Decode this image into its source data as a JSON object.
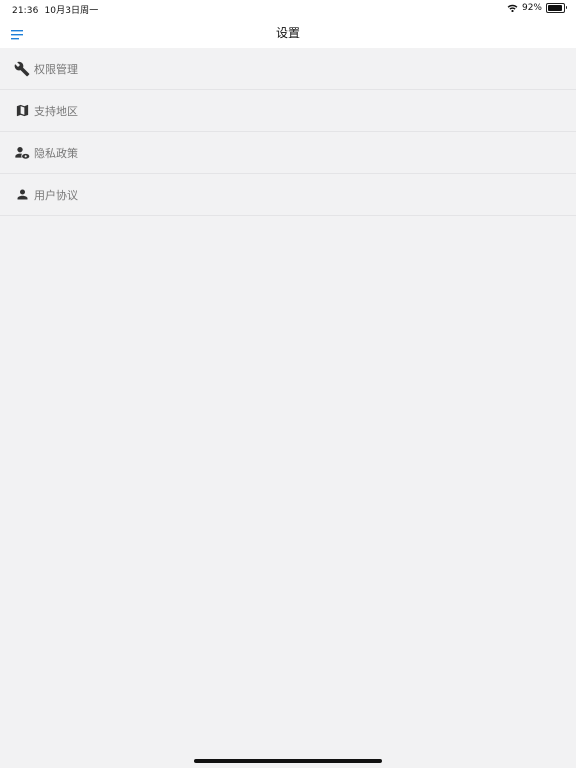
{
  "status_bar": {
    "time": "21:36",
    "date": "10月3日周一",
    "battery_text": "92%",
    "battery_level": 0.92,
    "wifi_icon": "wifi-icon",
    "battery_icon": "battery-icon"
  },
  "nav": {
    "title": "设置",
    "menu_icon": "menu-icon",
    "accent_color": "#1e7fd8"
  },
  "settings": {
    "items": [
      {
        "label": "权限管理",
        "icon": "wrench-icon"
      },
      {
        "label": "支持地区",
        "icon": "map-icon"
      },
      {
        "label": "隐私政策",
        "icon": "user-privacy-icon"
      },
      {
        "label": "用户协议",
        "icon": "person-icon"
      }
    ]
  }
}
